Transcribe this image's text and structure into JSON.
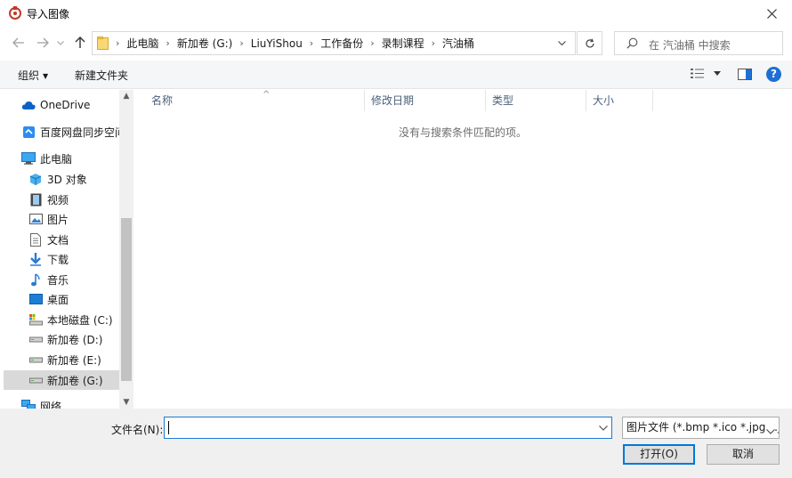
{
  "window": {
    "title": "导入图像",
    "app_icon": "app-logo-icon",
    "close_icon": "close-icon"
  },
  "address": {
    "crumbs": [
      "此电脑",
      "新加卷 (G:)",
      "LiuYiShou",
      "工作备份",
      "录制课程",
      "汽油桶"
    ],
    "search_placeholder": "在 汽油桶 中搜索"
  },
  "toolbar": {
    "organize_label": "组织",
    "new_folder_label": "新建文件夹"
  },
  "nav": {
    "items": [
      {
        "label": "OneDrive",
        "icon": "cloud-icon"
      },
      {
        "label": "百度网盘同步空间",
        "icon": "baidu-netdisk-icon"
      },
      {
        "label": "此电脑",
        "icon": "computer-icon"
      },
      {
        "label": "3D 对象",
        "icon": "cube-icon"
      },
      {
        "label": "视频",
        "icon": "video-icon"
      },
      {
        "label": "图片",
        "icon": "picture-icon"
      },
      {
        "label": "文档",
        "icon": "document-icon"
      },
      {
        "label": "下载",
        "icon": "download-icon"
      },
      {
        "label": "音乐",
        "icon": "music-icon"
      },
      {
        "label": "桌面",
        "icon": "desktop-icon"
      },
      {
        "label": "本地磁盘 (C:)",
        "icon": "system-drive-icon"
      },
      {
        "label": "新加卷 (D:)",
        "icon": "drive-icon"
      },
      {
        "label": "新加卷 (E:)",
        "icon": "drive-icon"
      },
      {
        "label": "新加卷 (G:)",
        "icon": "drive-icon"
      },
      {
        "label": "网络",
        "icon": "network-icon"
      }
    ],
    "selected_index": 13
  },
  "filelist": {
    "columns": [
      "名称",
      "修改日期",
      "类型",
      "大小"
    ],
    "empty_message": "没有与搜索条件匹配的项。"
  },
  "footer": {
    "filename_label": "文件名(N):",
    "filename_value": "",
    "filter_value": "图片文件 (*.bmp *.ico *.jpg *.jpe",
    "open_label": "打开(O)",
    "cancel_label": "取消"
  },
  "colors": {
    "accent": "#0078d7",
    "selection": "#cce8ff",
    "folder": "#f5c451",
    "help": "#1e6fd4"
  }
}
